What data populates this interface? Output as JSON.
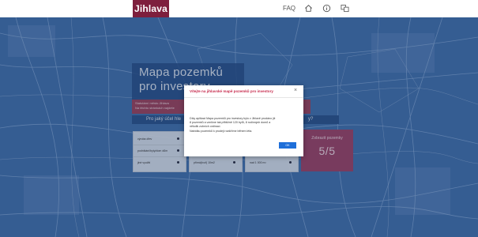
{
  "header": {
    "brand": "Jihlava",
    "faq": "FAQ",
    "icons": [
      "home-icon",
      "info-icon",
      "language-icon"
    ]
  },
  "hero": {
    "title_line1": "Mapa pozemků",
    "title_line2": "pro investory",
    "desc_line1": "Statutární město Jihlava",
    "desc_line2": "Na těchto stránkách najdete",
    "question": "Pro jaký účel hle",
    "question_end": "y?"
  },
  "filters": {
    "col1": [
      "výroba dřev",
      "podnikání/byty/dom dům",
      "jiné využití"
    ],
    "col2": [
      "přímá(tvoř) 10m2"
    ],
    "col3": [
      "nad 1 000 m²"
    ]
  },
  "show_card": {
    "label": "Zobrazit pozemky",
    "count": "5/5"
  },
  "modal": {
    "title": "Vítejte na jihlavské mapě pozemků pro investory",
    "body_line1": "Díky aplikaci Mapa pozemků pro investory bylo v Jihlavě prodáno již",
    "body_line2": "8 pozemků a vznikne tak přibližně 120 bytů, 8 rodinných domů a",
    "body_line3": "několik zubních ordinací.",
    "body_line4": "Nabídku pozemků k prodeji rozšíříme během léta.",
    "ok_label": "OK",
    "close_symbol": "×"
  },
  "colors": {
    "brand": "#7e1f3d",
    "accent_red": "#c72c4e",
    "ok_blue": "#1f6fd9",
    "map_blue": "#3f6fae"
  }
}
